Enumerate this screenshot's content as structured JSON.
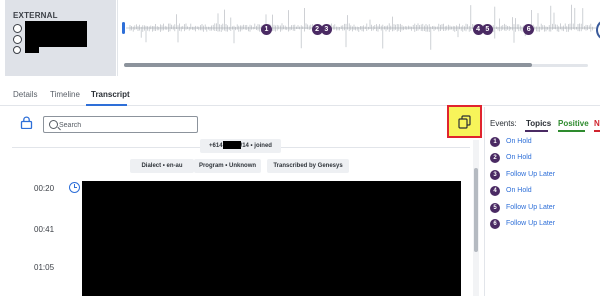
{
  "participant": {
    "label": "EXTERNAL"
  },
  "waveform": {
    "markers": [
      {
        "label": "1",
        "at": 0.3
      },
      {
        "label": "2",
        "at": 0.41
      },
      {
        "label": "3",
        "at": 0.43
      },
      {
        "label": "4",
        "at": 0.76
      },
      {
        "label": "5",
        "at": 0.78
      },
      {
        "label": "6",
        "at": 0.87
      }
    ],
    "scroll_position": 0.88
  },
  "tabs": [
    {
      "label": "Details"
    },
    {
      "label": "Timeline"
    },
    {
      "label": "Transcript",
      "active": true
    }
  ],
  "transcript": {
    "search_placeholder": "Search",
    "joined_prefix": "+614",
    "joined_suffix": "/14 • joined",
    "chips": {
      "dialect": "Dialect • en-au",
      "program": "Program • Unknown",
      "transcribed": "Transcribed by Genesys"
    },
    "timestamps": [
      "00:20",
      "00:41",
      "01:05"
    ]
  },
  "events": {
    "label": "Events:",
    "filters": [
      {
        "label": "Topics",
        "color": "#4a2a63"
      },
      {
        "label": "Positive",
        "color": "#2e8b2e"
      },
      {
        "label": "N",
        "color": "#d0242e"
      }
    ],
    "items": [
      {
        "number": "1",
        "label": "On Hold"
      },
      {
        "number": "2",
        "label": "On Hold"
      },
      {
        "number": "3",
        "label": "Follow Up Later"
      },
      {
        "number": "4",
        "label": "On Hold"
      },
      {
        "number": "5",
        "label": "Follow Up Later"
      },
      {
        "number": "6",
        "label": "Follow Up Later"
      }
    ]
  },
  "colors": {
    "accent": "#2e6fd8",
    "event_badge": "#4a2a63",
    "highlight": "#f7f45a",
    "highlight_border": "#e0242e"
  }
}
